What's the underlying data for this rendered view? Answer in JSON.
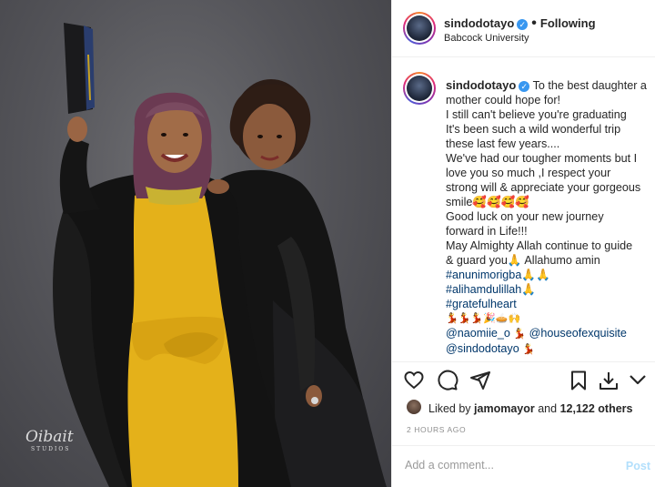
{
  "post": {
    "username": "sindodotayo",
    "follow_status": "Following",
    "location": "Babcock University",
    "verified_mark": "✓",
    "separator": "•"
  },
  "photo": {
    "watermark": "Oibait",
    "watermark_sub": "STUDIOS"
  },
  "caption": {
    "username": "sindodotayo",
    "lines": [
      "To the best daughter a",
      "mother could hope for!",
      "I still can't believe you're graduating",
      "It's been such a wild wonderful trip",
      "these last few years....",
      "We've had our tougher moments but I",
      "love you so much ,I respect your",
      "strong will & appreciate your gorgeous",
      "smile🥰🥰🥰🥰",
      "Good luck on your new journey",
      "forward in Life!!!",
      "May Almighty Allah continue to guide",
      "& guard you🙏 Allahumo amin"
    ],
    "hashtags": [
      "#anunimorigba🙏🙏",
      "#alihamdulillah🙏",
      "#gratefulheart"
    ],
    "emoji_row": "💃💃💃🎉🥧🙌",
    "mention_line_1_a": "@naomiie_o",
    "mention_line_1_mid": " 💃 ",
    "mention_line_1_b": "@houseofexquisite",
    "mention_line_2": "@sindodotayo",
    "mention_line_2_emoji": " 💃"
  },
  "actions": {
    "icons": [
      "heart-icon",
      "comment-icon",
      "share-icon",
      "bookmark-icon",
      "download-icon",
      "more-icon"
    ]
  },
  "likes": {
    "prefix": "Liked by",
    "user": "jamomayor",
    "middle": "and",
    "count": "12,122 others"
  },
  "timestamp": "2 HOURS AGO",
  "comment": {
    "placeholder": "Add a comment...",
    "post_label": "Post"
  },
  "colors": {
    "verified": "#3897f0",
    "link": "#00376b",
    "post_disabled": "#b2dffc",
    "dress": "#e8b41a"
  }
}
